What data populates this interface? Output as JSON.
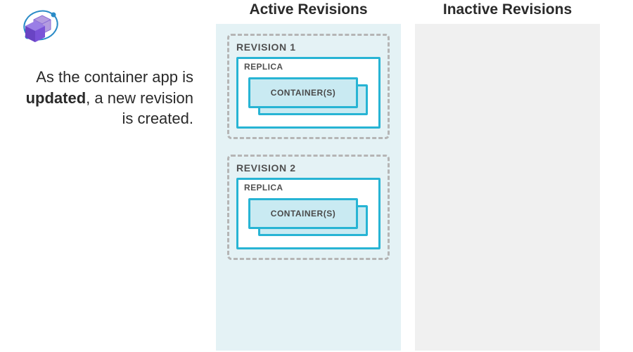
{
  "headers": {
    "active": "Active Revisions",
    "inactive": "Inactive Revisions"
  },
  "description": {
    "pre": "As the container app is ",
    "bold": "updated",
    "post": ", a new revision is created."
  },
  "revisions": {
    "active": [
      {
        "title": "REVISION 1",
        "replica_label": "REPLICA",
        "container_label": "CONTAINER(S)"
      },
      {
        "title": "REVISION 2",
        "replica_label": "REPLICA",
        "container_label": "CONTAINER(S)"
      }
    ]
  },
  "icon": {
    "name": "azure-container-apps"
  },
  "colors": {
    "active_bg": "#e4f2f5",
    "inactive_bg": "#f0f0f0",
    "border_cyan": "#27b4d4",
    "fill_cyan": "#c9eaf2",
    "dash_gray": "#b5b5b5"
  }
}
